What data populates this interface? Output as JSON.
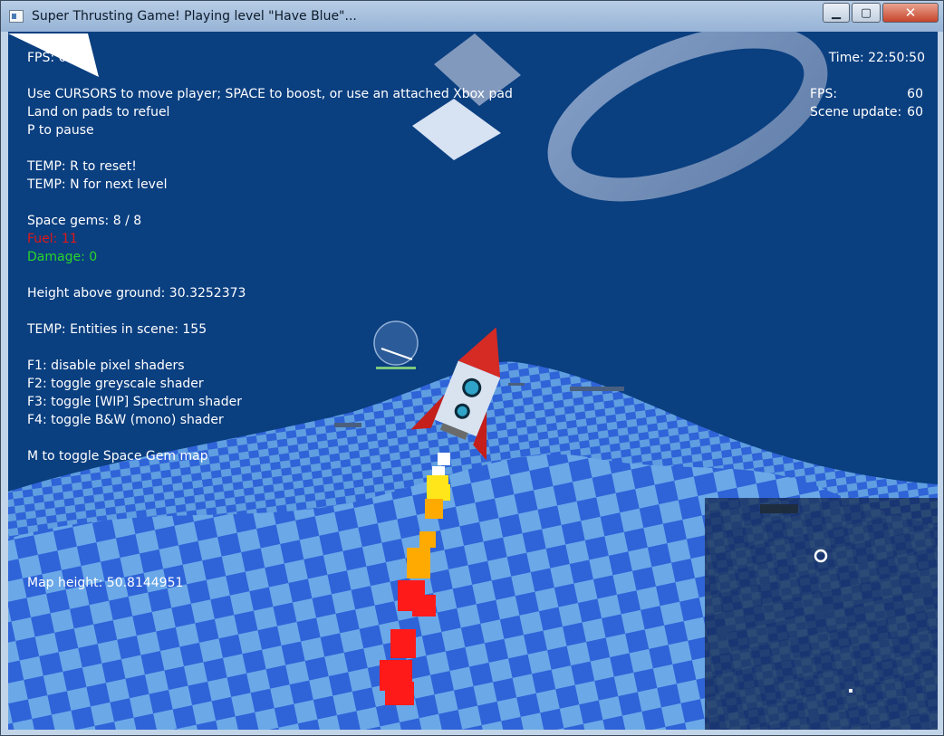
{
  "window": {
    "title": "Super Thrusting Game! Playing level \"Have Blue\"...",
    "min_glyph": "▁",
    "max_glyph": "▢",
    "close_glyph": "✕"
  },
  "hud_left": {
    "fps": "FPS: 60",
    "instructions_1": "Use CURSORS to move player; SPACE to boost, or use an attached Xbox pad",
    "instructions_2": "Land on pads to refuel",
    "instructions_3": "P to pause",
    "temp_reset": "TEMP: R to reset!",
    "temp_next": "TEMP: N for next level",
    "space_gems": "Space gems: 8 / 8",
    "fuel": "Fuel: 11",
    "damage": "Damage: 0",
    "height": "Height above ground: 30.3252373",
    "entities": "TEMP: Entities in scene: 155",
    "f1": "F1: disable pixel shaders",
    "f2": "F2: toggle greyscale shader",
    "f3": "F3: toggle [WIP] Spectrum shader",
    "f4": "F4: toggle B&W (mono) shader",
    "map_toggle": "M to toggle Space Gem map",
    "map_height": "Map height: 50.8144951"
  },
  "hud_right": {
    "time": "Time: 22:50:50",
    "fps_label": "FPS:",
    "fps_value": "60",
    "scene_label": "Scene update:",
    "scene_value": "60"
  },
  "colors": {
    "sky": "#0a3f80",
    "ground_light": "#6aa8e8",
    "ground_dark": "#2f63d8",
    "fuel": "#e01818",
    "damage": "#29d629"
  }
}
